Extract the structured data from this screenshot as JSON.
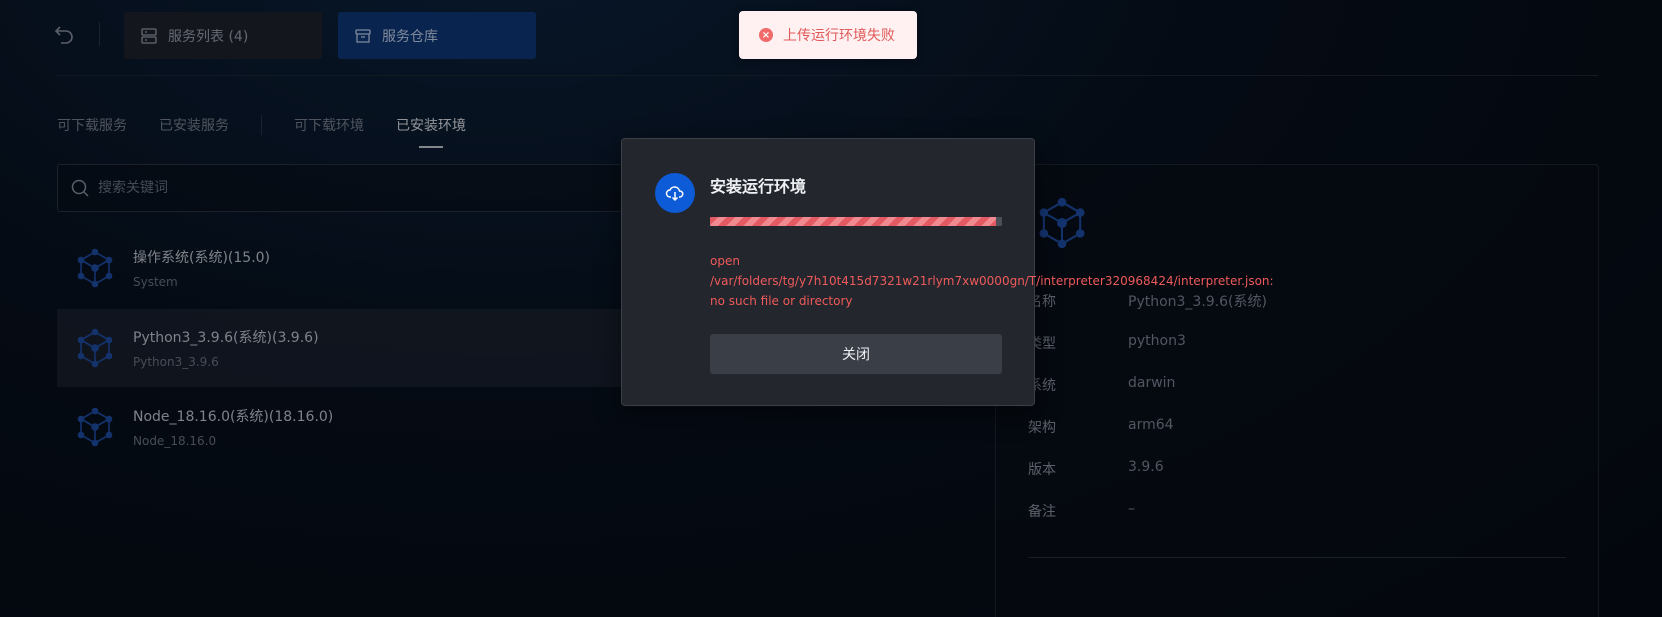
{
  "toolbar": {
    "back_icon": "undo-icon",
    "service_list_label": "服务列表 (4)",
    "service_repo_label": "服务仓库"
  },
  "tabs": [
    {
      "label": "可下载服务",
      "active": false
    },
    {
      "label": "已安装服务",
      "active": false
    },
    {
      "label": "可下载环境",
      "active": false
    },
    {
      "label": "已安装环境",
      "active": true
    }
  ],
  "search": {
    "placeholder": "搜索关键词",
    "value": ""
  },
  "environments": [
    {
      "name": "操作系统(系统)(15.0)",
      "sub": "System",
      "selected": false
    },
    {
      "name": "Python3_3.9.6(系统)(3.9.6)",
      "sub": "Python3_3.9.6",
      "selected": true
    },
    {
      "name": "Node_18.16.0(系统)(18.16.0)",
      "sub": "Node_18.16.0",
      "selected": false
    }
  ],
  "detail": {
    "rows": [
      {
        "key": "名称",
        "value": "Python3_3.9.6(系统)"
      },
      {
        "key": "类型",
        "value": "python3"
      },
      {
        "key": "系统",
        "value": "darwin"
      },
      {
        "key": "架构",
        "value": "arm64"
      },
      {
        "key": "版本",
        "value": "3.9.6"
      },
      {
        "key": "备注",
        "value": "–"
      }
    ]
  },
  "toast": {
    "message": "上传运行环境失败",
    "type": "error"
  },
  "modal": {
    "title": "安装运行环境",
    "progress": 0.98,
    "error_lines": [
      "open",
      "/var/folders/tg/y7h10t415d7321w21rlym7xw0000gn/T/interpreter320968424/interpreter.json:",
      "no such file or directory"
    ],
    "close_label": "关闭"
  },
  "colors": {
    "accent": "#0d5bd7",
    "error": "#ef5a5a",
    "toast_bg": "#fff1f1"
  }
}
